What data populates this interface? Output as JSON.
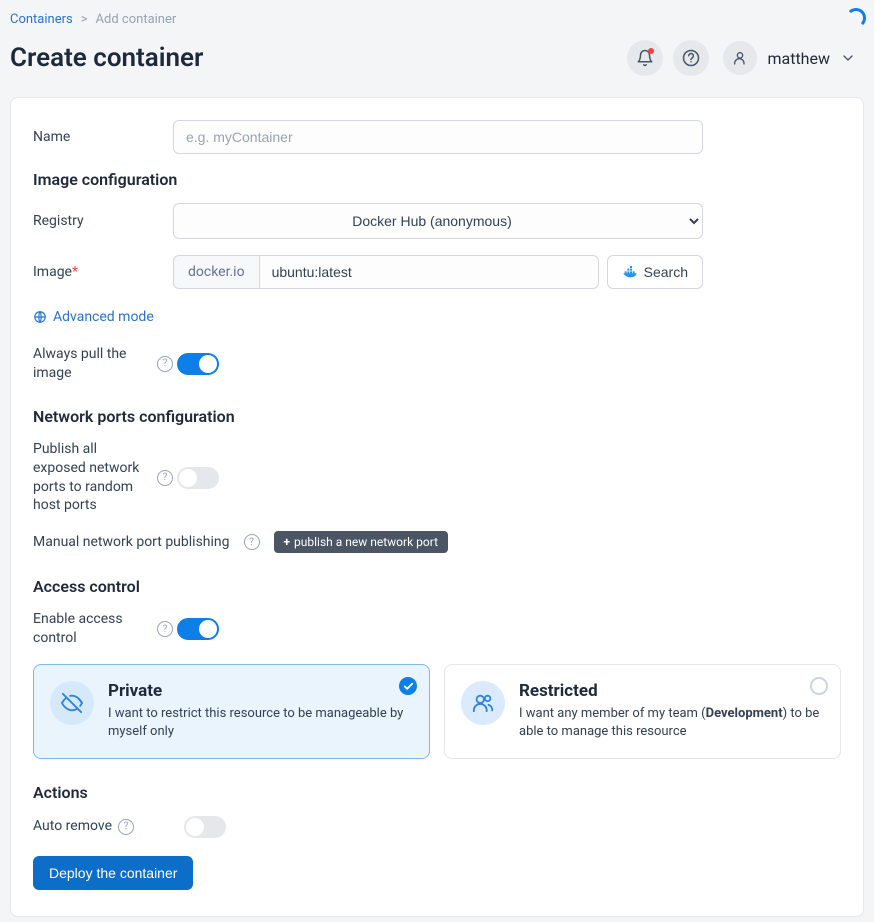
{
  "breadcrumb": {
    "root": "Containers",
    "current": "Add container",
    "sep": ">"
  },
  "page_title": "Create container",
  "user": {
    "name": "matthew"
  },
  "form": {
    "name": {
      "label": "Name",
      "placeholder": "e.g. myContainer",
      "value": ""
    },
    "image_config_heading": "Image configuration",
    "registry": {
      "label": "Registry",
      "value": "Docker Hub (anonymous)"
    },
    "image": {
      "label": "Image",
      "required": "*",
      "prefix": "docker.io",
      "value": "ubuntu:latest",
      "search_label": "Search"
    },
    "advanced_link": "Advanced mode",
    "always_pull": {
      "label": "Always pull the image",
      "on": true
    },
    "network_heading": "Network ports configuration",
    "publish_all": {
      "label": "Publish all exposed network ports to random host ports",
      "on": false
    },
    "manual_publish": {
      "label": "Manual network port publishing",
      "button": "publish a new network port"
    },
    "access_heading": "Access control",
    "enable_access": {
      "label": "Enable access control",
      "on": true
    },
    "access_options": {
      "private": {
        "title": "Private",
        "desc": "I want to restrict this resource to be manageable by myself only"
      },
      "restricted": {
        "title": "Restricted",
        "desc_pre": "I want any member of my team (",
        "team": "Development",
        "desc_post": ") to be able to manage this resource"
      }
    },
    "actions_heading": "Actions",
    "auto_remove": {
      "label": "Auto remove",
      "on": false
    },
    "deploy_label": "Deploy the container"
  }
}
